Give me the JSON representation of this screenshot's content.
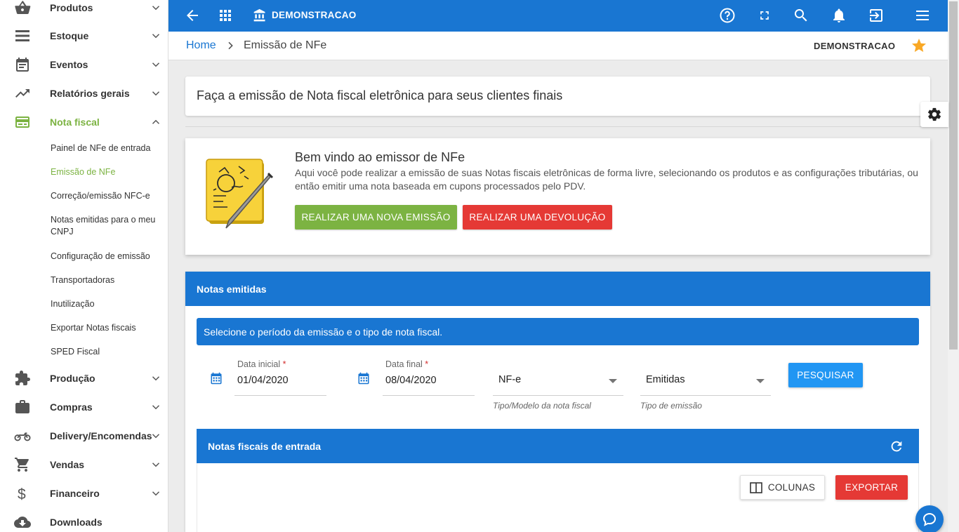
{
  "sidebar": {
    "menu": [
      {
        "label": "Produtos",
        "icon": "basket-icon"
      },
      {
        "label": "Estoque",
        "icon": "list-icon"
      },
      {
        "label": "Eventos",
        "icon": "calendar-icon"
      },
      {
        "label": "Relatórios gerais",
        "icon": "trending-up-icon"
      },
      {
        "label": "Nota fiscal",
        "icon": "receipt-icon"
      },
      {
        "label": "Produção",
        "icon": "puzzle-icon"
      },
      {
        "label": "Compras",
        "icon": "briefcase-icon"
      },
      {
        "label": "Delivery/Encomendas",
        "icon": "motorbike-icon"
      },
      {
        "label": "Vendas",
        "icon": "cart-icon"
      },
      {
        "label": "Financeiro",
        "icon": "dollar-icon"
      },
      {
        "label": "Downloads",
        "icon": "cloud-download-icon"
      }
    ],
    "submenu": [
      "Painel de NFe de entrada",
      "Emissão de NFe",
      "Correção/emissão NFC-e",
      "Notas emitidas para o meu CNPJ",
      "Configuração de emissão",
      "Transportadoras",
      "Inutilização",
      "Exportar Notas fiscais",
      "SPED Fiscal"
    ]
  },
  "topbar": {
    "company": "DEMONSTRACAO"
  },
  "breadcrumb": {
    "home": "Home",
    "current": "Emissão de NFe",
    "company": "DEMONSTRACAO"
  },
  "intro": {
    "text": "Faça a emissão de Nota fiscal eletrônica para seus clientes finais"
  },
  "welcome": {
    "title": "Bem vindo ao emissor de NFe",
    "description": "Aqui você pode realizar a emissão de suas Notas fiscais eletrônicas de forma livre, selecionando os produtos e as configurações tributárias, ou então emitir uma nota baseada em cupons processados pelo PDV.",
    "btn_new": "REALIZAR UMA NOVA EMISSÃO",
    "btn_return": "REALIZAR UMA DEVOLUÇÃO"
  },
  "notas": {
    "title": "Notas emitidas",
    "info": "Selecione o período da emissão e o tipo de nota fiscal.",
    "date_start_label": "Data inicial",
    "date_start_value": "01/04/2020",
    "date_end_label": "Data final",
    "date_end_value": "08/04/2020",
    "required_mark": "*",
    "type_value": "NF-e",
    "type_hint": "Tipo/Modelo da nota fiscal",
    "emission_value": "Emitidas",
    "emission_hint": "Tipo de emissão",
    "search_btn": "PESQUISAR",
    "table_title": "Notas fiscais de entrada",
    "columns_btn": "COLUNAS",
    "export_btn": "EXPORTAR"
  },
  "colors": {
    "primary": "#1976d2",
    "green": "#7cb342",
    "red": "#e53935",
    "star": "#f9a825"
  }
}
